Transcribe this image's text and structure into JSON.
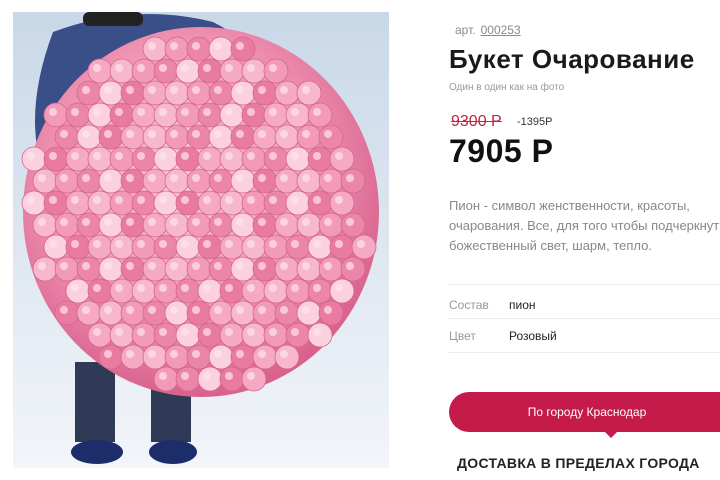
{
  "product": {
    "article_label": "арт.",
    "article_code": "000253",
    "title": "Букет Очарование",
    "subtitle": "Один в один как на фото",
    "old_price": "9300 Р",
    "discount": "-1395Р",
    "price": "7905 Р",
    "description": "Пион - символ женственности, красоты, очарования. Все, для того чтобы подчеркнуть божественный свет, шарм, тепло."
  },
  "specs": [
    {
      "label": "Состав",
      "value": "пион"
    },
    {
      "label": "Цвет",
      "value": "Розовый"
    }
  ],
  "delivery": {
    "button_label": "По городу Краснодар",
    "note": "ДОСТАВКА В ПРЕДЕЛАХ ГОРОДА"
  },
  "colors": {
    "accent": "#c41b4a",
    "old_price": "#c0243f",
    "peony_pink": "#f29ab8"
  }
}
